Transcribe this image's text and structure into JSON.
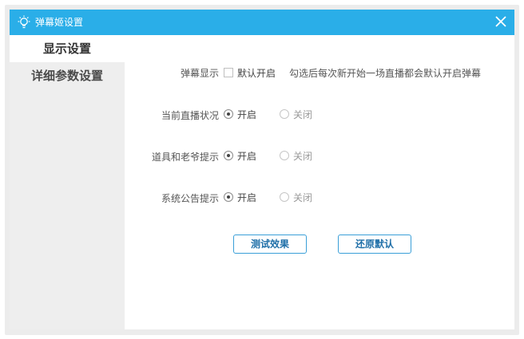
{
  "window": {
    "title": "弹幕姬设置",
    "accent": "#2aaee8"
  },
  "sidebar": {
    "items": [
      {
        "label": "显示设置",
        "active": true
      },
      {
        "label": "详细参数设置",
        "active": false
      }
    ]
  },
  "settings": {
    "danmaku": {
      "label": "弹幕显示",
      "checkbox_label": "默认开启",
      "checked": false,
      "hint": "勾选后每次新开始一场直播都会默认开启弹幕"
    },
    "live_status": {
      "label": "当前直播状况",
      "on": "开启",
      "off": "关闭",
      "selected": "开启"
    },
    "props": {
      "label": "道具和老爷提示",
      "on": "开启",
      "off": "关闭",
      "selected": "开启"
    },
    "announce": {
      "label": "系统公告提示",
      "on": "开启",
      "off": "关闭",
      "selected": "开启"
    }
  },
  "buttons": {
    "test": "测试效果",
    "reset": "还原默认"
  }
}
